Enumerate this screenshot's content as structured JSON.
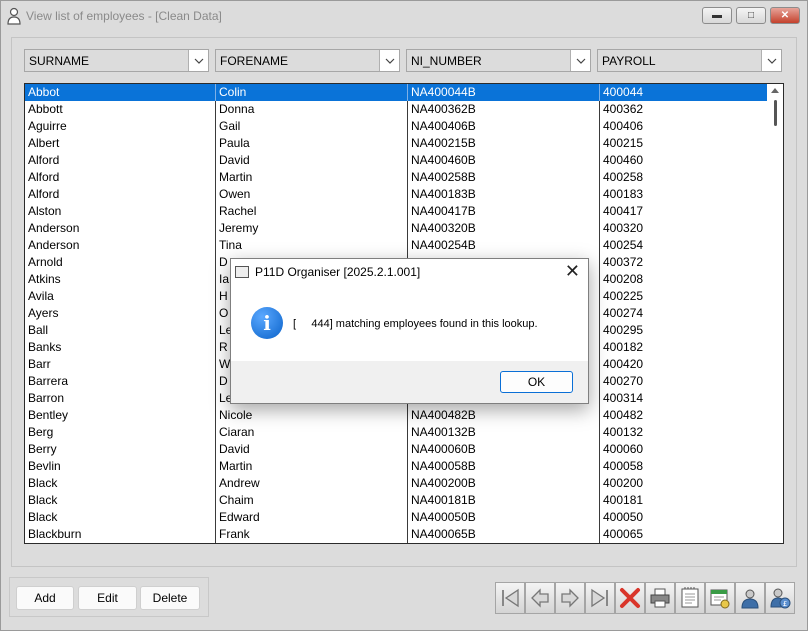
{
  "window": {
    "title": "View list of employees - [Clean Data]",
    "minimize_icon": "minimize-icon",
    "maximize_icon": "maximize-icon",
    "close_icon": "close-icon"
  },
  "grid": {
    "columns": [
      {
        "label": "SURNAME"
      },
      {
        "label": "FORENAME"
      },
      {
        "label": "NI_NUMBER"
      },
      {
        "label": "PAYROLL"
      }
    ],
    "rows": [
      {
        "surname": "Abbot",
        "forename": "Colin",
        "ni": "NA400044B",
        "payroll": "400044",
        "selected": true
      },
      {
        "surname": "Abbott",
        "forename": "Donna",
        "ni": "NA400362B",
        "payroll": "400362"
      },
      {
        "surname": "Aguirre",
        "forename": "Gail",
        "ni": "NA400406B",
        "payroll": "400406"
      },
      {
        "surname": "Albert",
        "forename": "Paula",
        "ni": "NA400215B",
        "payroll": "400215"
      },
      {
        "surname": "Alford",
        "forename": "David",
        "ni": "NA400460B",
        "payroll": "400460"
      },
      {
        "surname": "Alford",
        "forename": "Martin",
        "ni": "NA400258B",
        "payroll": "400258"
      },
      {
        "surname": "Alford",
        "forename": "Owen",
        "ni": "NA400183B",
        "payroll": "400183"
      },
      {
        "surname": "Alston",
        "forename": "Rachel",
        "ni": "NA400417B",
        "payroll": "400417"
      },
      {
        "surname": "Anderson",
        "forename": "Jeremy",
        "ni": "NA400320B",
        "payroll": "400320"
      },
      {
        "surname": "Anderson",
        "forename": "Tina",
        "ni": "NA400254B",
        "payroll": "400254"
      },
      {
        "surname": "Arnold",
        "forename": "D",
        "ni": "",
        "payroll": "400372"
      },
      {
        "surname": "Atkins",
        "forename": "Ia",
        "ni": "",
        "payroll": "400208"
      },
      {
        "surname": "Avila",
        "forename": "H",
        "ni": "",
        "payroll": "400225"
      },
      {
        "surname": "Ayers",
        "forename": "O",
        "ni": "",
        "payroll": "400274"
      },
      {
        "surname": "Ball",
        "forename": "Le",
        "ni": "",
        "payroll": "400295"
      },
      {
        "surname": "Banks",
        "forename": "R",
        "ni": "",
        "payroll": "400182"
      },
      {
        "surname": "Barr",
        "forename": "W",
        "ni": "",
        "payroll": "400420"
      },
      {
        "surname": "Barrera",
        "forename": "D",
        "ni": "",
        "payroll": "400270"
      },
      {
        "surname": "Barron",
        "forename": "Le",
        "ni": "",
        "payroll": "400314"
      },
      {
        "surname": "Bentley",
        "forename": "Nicole",
        "ni": "NA400482B",
        "payroll": "400482"
      },
      {
        "surname": "Berg",
        "forename": "Ciaran",
        "ni": "NA400132B",
        "payroll": "400132"
      },
      {
        "surname": "Berry",
        "forename": "David",
        "ni": "NA400060B",
        "payroll": "400060"
      },
      {
        "surname": "Bevlin",
        "forename": "Martin",
        "ni": "NA400058B",
        "payroll": "400058"
      },
      {
        "surname": "Black",
        "forename": "Andrew",
        "ni": "NA400200B",
        "payroll": "400200"
      },
      {
        "surname": "Black",
        "forename": "Chaim",
        "ni": "NA400181B",
        "payroll": "400181"
      },
      {
        "surname": "Black",
        "forename": "Edward",
        "ni": "NA400050B",
        "payroll": "400050"
      },
      {
        "surname": "Blackburn",
        "forename": "Frank",
        "ni": "NA400065B",
        "payroll": "400065"
      }
    ]
  },
  "buttons": {
    "add": "Add",
    "edit": "Edit",
    "delete": "Delete"
  },
  "toolbar_icons": [
    "first-record-icon",
    "previous-record-icon",
    "next-record-icon",
    "last-record-icon",
    "delete-record-icon",
    "print-icon",
    "report-icon",
    "payroll-report-icon",
    "employee-icon",
    "employee-pay-icon"
  ],
  "dialog": {
    "title": "P11D Organiser [2025.2.1.001]",
    "message": "[     444] matching employees found in this lookup.",
    "ok_label": "OK",
    "icon": "information-icon"
  },
  "colors": {
    "selection": "#0a73d8",
    "window_bg": "#dcdcdc"
  }
}
